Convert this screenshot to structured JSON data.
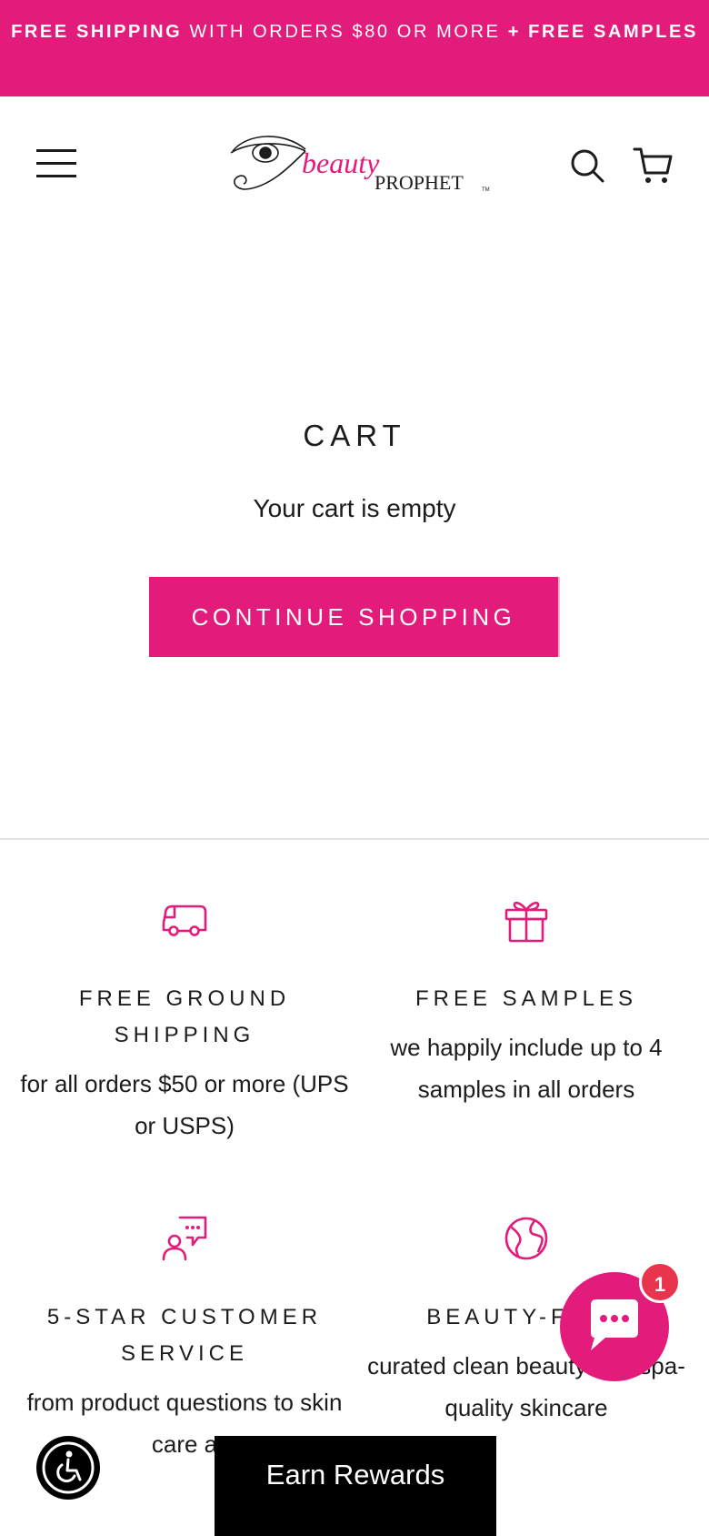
{
  "announcement": {
    "bold1": "FREE SHIPPING",
    "regular": " WITH ORDERS $80 OR MORE ",
    "bold2": "+ FREE SAMPLES"
  },
  "header": {
    "logo_script": "beauty",
    "logo_caps": "PROPHET",
    "logo_tm": "TM",
    "icons": [
      "menu-icon",
      "search-icon",
      "cart-icon"
    ]
  },
  "cart": {
    "title": "CART",
    "empty_message": "Your cart is empty",
    "continue_label": "CONTINUE SHOPPING"
  },
  "features": [
    {
      "icon": "truck-icon",
      "title": "FREE GROUND SHIPPING",
      "desc": "for all orders $50 or more (UPS or USPS)"
    },
    {
      "icon": "gift-icon",
      "title": "FREE SAMPLES",
      "desc": "we happily include up to 4 samples in all orders"
    },
    {
      "icon": "chat-support-icon",
      "title": "5-STAR CUSTOMER SERVICE",
      "desc": "from product questions to skin care a"
    },
    {
      "icon": "globe-icon",
      "title": "BEAUTY-FUL I",
      "desc": "curated clean beauty and spa-quality skincare"
    }
  ],
  "widgets": {
    "rewards_label": "Earn Rewards",
    "chat_badge": "1",
    "accessibility_icon": "accessibility-icon"
  },
  "colors": {
    "brand_pink": "#e31b7b",
    "badge_red": "#e8344c",
    "text": "#1c1c1c"
  }
}
